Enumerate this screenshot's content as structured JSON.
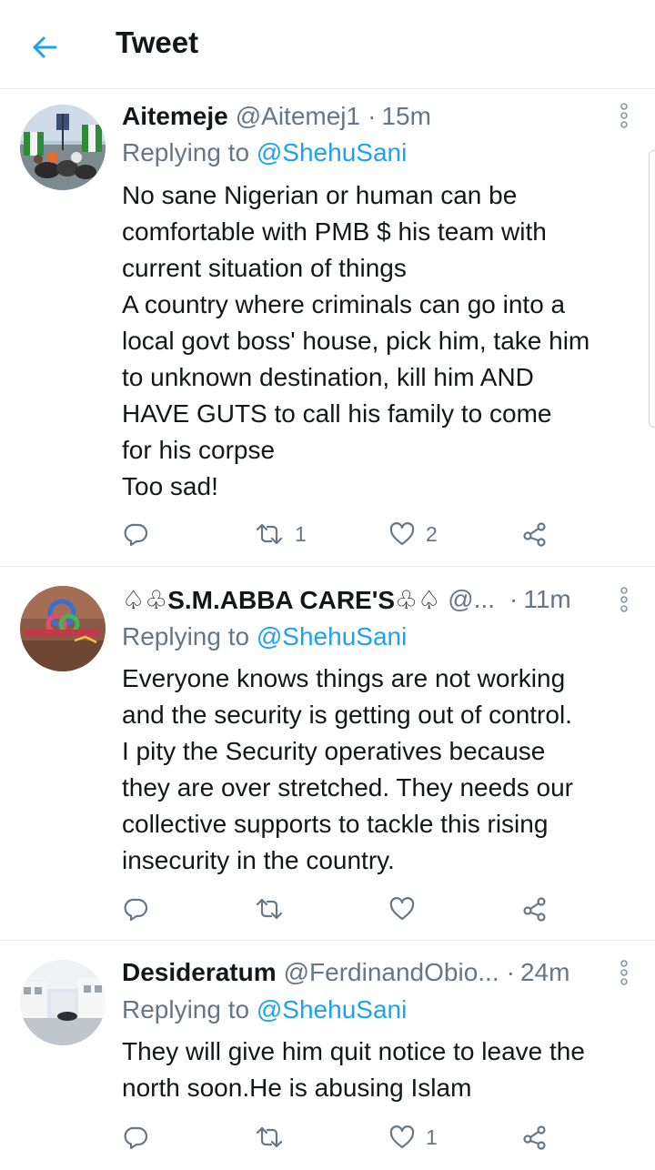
{
  "header": {
    "title": "Tweet"
  },
  "colors": {
    "accent": "#1da1f2",
    "muted": "#657786",
    "text": "#14171a",
    "divider": "#e6ecf0"
  },
  "tweets": [
    {
      "name": "Aitemeje",
      "handle": "@Aitemej1",
      "separator": "·",
      "time": "15m",
      "replying_prefix": "Replying to",
      "replying_mention": "@ShehuSani",
      "lines": [
        "No sane Nigerian or human can be",
        "comfortable with PMB $ his team  with",
        "current situation of things",
        "A country where criminals can go into a",
        "local govt boss' house, pick him, take him",
        "to unknown destination, kill him AND",
        "HAVE GUTS  to call his family to come",
        "for his corpse",
        "Too sad!"
      ],
      "retweets": "1",
      "likes": "2"
    },
    {
      "name": "♤♧S.M.ABBA CARE'S♧♤",
      "handle": "@...",
      "separator": "·",
      "time": "11m",
      "replying_prefix": "Replying to",
      "replying_mention": "@ShehuSani",
      "lines": [
        "Everyone knows things are not working",
        "and the security is getting out of control.",
        "I pity the Security operatives because",
        "they are over stretched. They needs our",
        "collective supports to tackle this rising",
        "insecurity in the country."
      ],
      "retweets": "",
      "likes": ""
    },
    {
      "name": "Desideratum",
      "handle": "@FerdinandObio...",
      "separator": "·",
      "time": "24m",
      "replying_prefix": "Replying to",
      "replying_mention": "@ShehuSani",
      "lines": [
        "They will give him quit notice to leave the",
        "north soon.He is abusing Islam"
      ],
      "retweets": "",
      "likes": "1"
    }
  ]
}
